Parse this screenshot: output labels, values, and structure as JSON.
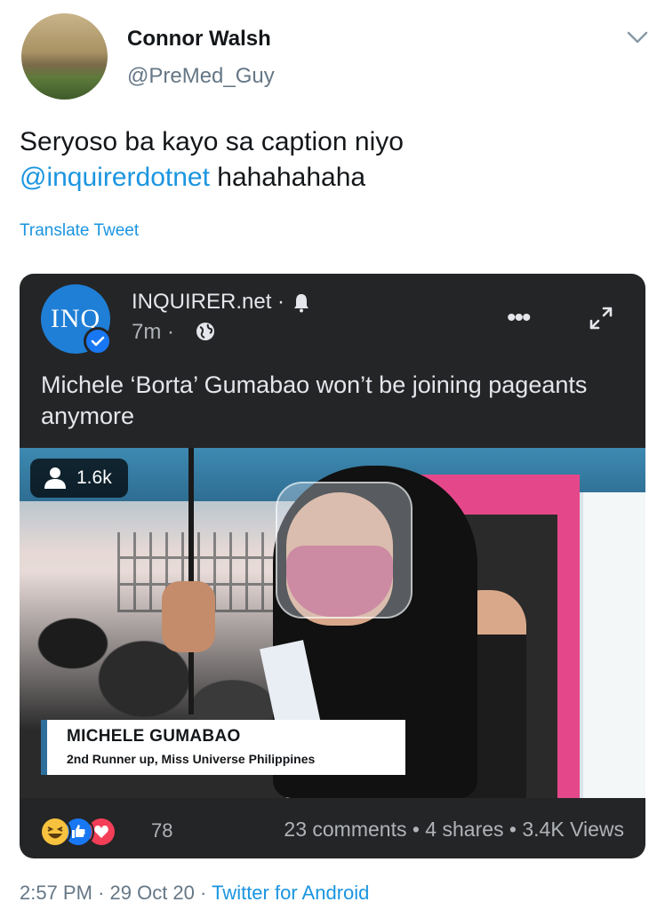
{
  "tweet": {
    "display_name": "Connor Walsh",
    "handle": "@PreMed_Guy",
    "text_before": "Seryoso ba kayo sa caption niyo",
    "mention": "@inquirerdotnet",
    "text_after": " hahahahaha",
    "translate_label": "Translate Tweet",
    "time": "2:57 PM",
    "sep": "·",
    "date": "29 Oct 20",
    "source": "Twitter for Android"
  },
  "card": {
    "avatar_text": "INQ",
    "page_name": "INQUIRER.net",
    "page_name_sep": "·",
    "age": "7m",
    "age_sep": "·",
    "more_label": "•••",
    "headline": "Michele ‘Borta’ Gumabao won’t be joining pageants anymore",
    "views": "1.6k",
    "lower_third": {
      "name": "MICHELE GUMABAO",
      "title": "2nd Runner up, Miss Universe Philippines"
    },
    "reaction_count": "78",
    "stats": "23 comments • 4 shares • 3.4K Views"
  },
  "icons": {
    "chevron": "chevron-down-icon",
    "bell": "bell-icon",
    "globe": "globe-icon",
    "expand": "expand-icon",
    "verified": "verified-badge-icon",
    "person": "person-icon",
    "haha": "haha-reaction-icon",
    "like": "like-reaction-icon",
    "love": "love-reaction-icon"
  },
  "colors": {
    "link": "#1b95e0",
    "card_bg": "#242526",
    "fb_blue": "#1877f2"
  }
}
